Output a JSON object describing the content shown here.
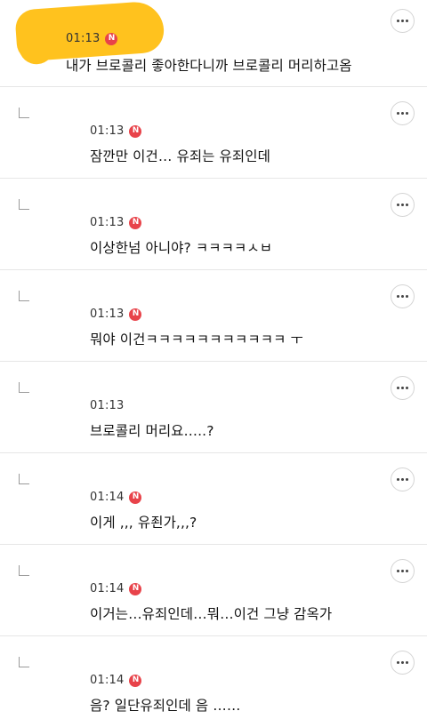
{
  "comments": [
    {
      "type": "top",
      "time": "01:13",
      "badge": "N",
      "text": "내가 브로콜리 좋아한다니까 브로콜리 머리하고옴"
    },
    {
      "type": "reply",
      "time": "01:13",
      "badge": "N",
      "text": "잠깐만 이건… 유죄는 유죄인데"
    },
    {
      "type": "reply",
      "time": "01:13",
      "badge": "N",
      "text": "이상한넘 아니야? ㅋㅋㅋㅋㅅㅂ"
    },
    {
      "type": "reply",
      "time": "01:13",
      "badge": "N",
      "text": "뭐야 이건ㅋㅋㅋㅋㅋㅋㅋㅋㅋㅋㅋ ㅜ"
    },
    {
      "type": "reply",
      "time": "01:13",
      "badge": "",
      "text": "브로콜리 머리요…..?"
    },
    {
      "type": "reply",
      "time": "01:14",
      "badge": "N",
      "text": "이게 ,,, 유죈가,,,?"
    },
    {
      "type": "reply",
      "time": "01:14",
      "badge": "N",
      "text": "이거는…유죄인데…뭐…이건 그냥 감옥가"
    },
    {
      "type": "reply",
      "time": "01:14",
      "badge": "N",
      "text": "음? 일단유죄인데 음 ……"
    }
  ]
}
